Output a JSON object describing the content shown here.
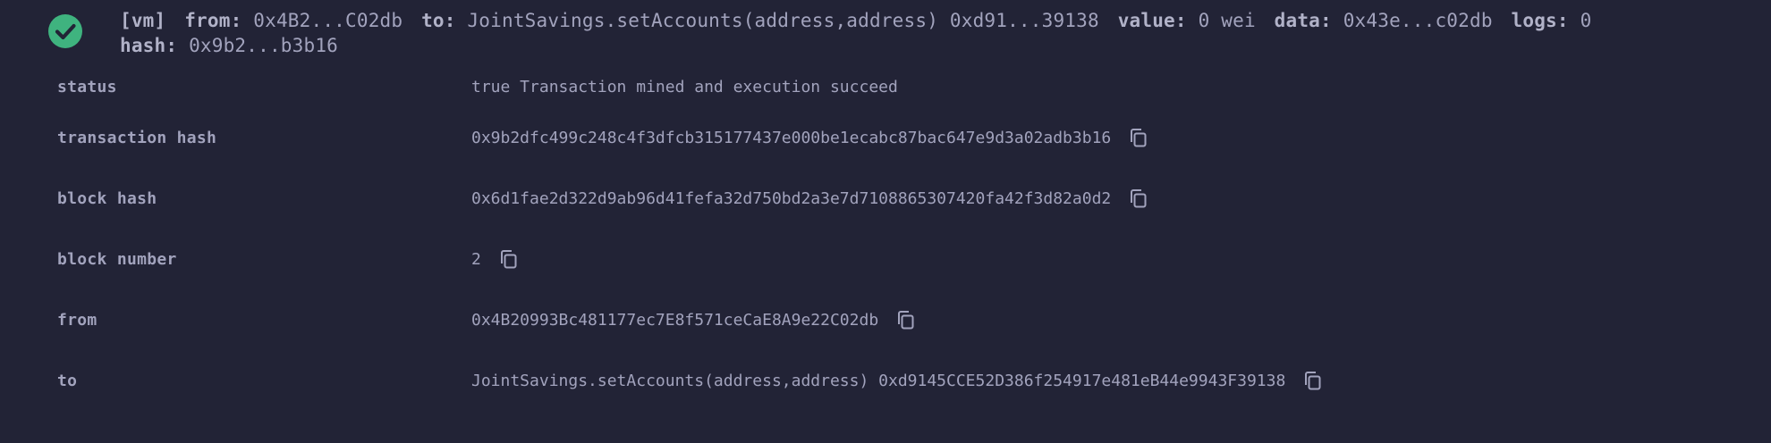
{
  "header": {
    "status_icon": "check-circle-icon",
    "env": "[vm]",
    "from_key": "from:",
    "from_value": "0x4B2...C02db",
    "to_key": "to:",
    "to_value": "JointSavings.setAccounts(address,address) 0xd91...39138",
    "value_key": "value:",
    "value_value": "0 wei",
    "data_key": "data:",
    "data_value": "0x43e...c02db",
    "logs_key": "logs:",
    "logs_value": "0",
    "hash_key": "hash:",
    "hash_value": "0x9b2...b3b16"
  },
  "details": [
    {
      "label": "status",
      "value": "true Transaction mined and execution succeed",
      "copy": false
    },
    {
      "label": "transaction hash",
      "value": "0x9b2dfc499c248c4f3dfcb315177437e000be1ecabc87bac647e9d3a02adb3b16",
      "copy": true
    },
    {
      "label": "block hash",
      "value": "0x6d1fae2d322d9ab96d41fefa32d750bd2a3e7d7108865307420fa42f3d82a0d2",
      "copy": true
    },
    {
      "label": "block number",
      "value": "2",
      "copy": true
    },
    {
      "label": "from",
      "value": "0x4B20993Bc481177ec7E8f571ceCaE8A9e22C02db",
      "copy": true
    },
    {
      "label": "to",
      "value": "JointSavings.setAccounts(address,address) 0xd9145CCE52D386f254917e481eB44e9943F39138",
      "copy": true
    }
  ],
  "colors": {
    "background": "#222336",
    "text": "#a2a3bd",
    "success_green": "#3fb37f"
  },
  "icons": {
    "copy": "copy-icon",
    "success": "check-circle-icon"
  }
}
